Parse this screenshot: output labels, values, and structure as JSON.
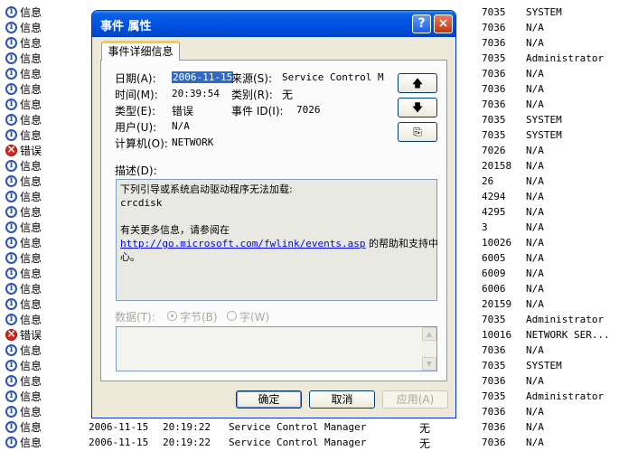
{
  "event_list": {
    "rows": [
      {
        "type": "信息",
        "icon": "info",
        "date": "",
        "time": "",
        "source": "",
        "category": "",
        "id": "7035",
        "user": "SYSTEM"
      },
      {
        "type": "信息",
        "icon": "info",
        "date": "",
        "time": "",
        "source": "",
        "category": "",
        "id": "7036",
        "user": "N/A"
      },
      {
        "type": "信息",
        "icon": "info",
        "date": "",
        "time": "",
        "source": "",
        "category": "",
        "id": "7036",
        "user": "N/A"
      },
      {
        "type": "信息",
        "icon": "info",
        "date": "",
        "time": "",
        "source": "",
        "category": "",
        "id": "7035",
        "user": "Administrator"
      },
      {
        "type": "信息",
        "icon": "info",
        "date": "",
        "time": "",
        "source": "",
        "category": "",
        "id": "7036",
        "user": "N/A"
      },
      {
        "type": "信息",
        "icon": "info",
        "date": "",
        "time": "",
        "source": "",
        "category": "",
        "id": "7036",
        "user": "N/A"
      },
      {
        "type": "信息",
        "icon": "info",
        "date": "",
        "time": "",
        "source": "",
        "category": "",
        "id": "7036",
        "user": "N/A"
      },
      {
        "type": "信息",
        "icon": "info",
        "date": "",
        "time": "",
        "source": "",
        "category": "",
        "id": "7035",
        "user": "SYSTEM"
      },
      {
        "type": "信息",
        "icon": "info",
        "date": "",
        "time": "",
        "source": "",
        "category": "",
        "id": "7035",
        "user": "SYSTEM"
      },
      {
        "type": "错误",
        "icon": "error",
        "date": "",
        "time": "",
        "source": "",
        "category": "",
        "id": "7026",
        "user": "N/A"
      },
      {
        "type": "信息",
        "icon": "info",
        "date": "",
        "time": "",
        "source": "",
        "category": "",
        "id": "20158",
        "user": "N/A"
      },
      {
        "type": "信息",
        "icon": "info",
        "date": "",
        "time": "",
        "source": "",
        "category": "",
        "id": "26",
        "user": "N/A"
      },
      {
        "type": "信息",
        "icon": "info",
        "date": "",
        "time": "",
        "source": "",
        "category": "",
        "id": "4294",
        "user": "N/A"
      },
      {
        "type": "信息",
        "icon": "info",
        "date": "",
        "time": "",
        "source": "",
        "category": "",
        "id": "4295",
        "user": "N/A"
      },
      {
        "type": "信息",
        "icon": "info",
        "date": "",
        "time": "",
        "source": "",
        "category": "",
        "id": "3",
        "user": "N/A"
      },
      {
        "type": "信息",
        "icon": "info",
        "date": "",
        "time": "",
        "source": "",
        "category": "",
        "id": "10026",
        "user": "N/A"
      },
      {
        "type": "信息",
        "icon": "info",
        "date": "",
        "time": "",
        "source": "",
        "category": "",
        "id": "6005",
        "user": "N/A"
      },
      {
        "type": "信息",
        "icon": "info",
        "date": "",
        "time": "",
        "source": "",
        "category": "",
        "id": "6009",
        "user": "N/A"
      },
      {
        "type": "信息",
        "icon": "info",
        "date": "",
        "time": "",
        "source": "",
        "category": "",
        "id": "6006",
        "user": "N/A"
      },
      {
        "type": "信息",
        "icon": "info",
        "date": "",
        "time": "",
        "source": "",
        "category": "",
        "id": "20159",
        "user": "N/A"
      },
      {
        "type": "信息",
        "icon": "info",
        "date": "",
        "time": "",
        "source": "",
        "category": "",
        "id": "7035",
        "user": "Administrator"
      },
      {
        "type": "错误",
        "icon": "error",
        "date": "",
        "time": "",
        "source": "",
        "category": "",
        "id": "10016",
        "user": "NETWORK SER..."
      },
      {
        "type": "信息",
        "icon": "info",
        "date": "",
        "time": "",
        "source": "",
        "category": "",
        "id": "7036",
        "user": "N/A"
      },
      {
        "type": "信息",
        "icon": "info",
        "date": "",
        "time": "",
        "source": "",
        "category": "",
        "id": "7035",
        "user": "SYSTEM"
      },
      {
        "type": "信息",
        "icon": "info",
        "date": "",
        "time": "",
        "source": "",
        "category": "",
        "id": "7036",
        "user": "N/A"
      },
      {
        "type": "信息",
        "icon": "info",
        "date": "",
        "time": "",
        "source": "",
        "category": "",
        "id": "7035",
        "user": "Administrator"
      },
      {
        "type": "信息",
        "icon": "info",
        "date": "",
        "time": "",
        "source": "",
        "category": "",
        "id": "7036",
        "user": "N/A"
      },
      {
        "type": "信息",
        "icon": "info",
        "date": "2006-11-15",
        "time": "20:19:22",
        "source": "Service Control Manager",
        "category": "无",
        "id": "7036",
        "user": "N/A"
      },
      {
        "type": "信息",
        "icon": "info",
        "date": "2006-11-15",
        "time": "20:19:22",
        "source": "Service Control Manager",
        "category": "无",
        "id": "7036",
        "user": "N/A"
      }
    ]
  },
  "dialog": {
    "title": "事件 属性",
    "help_label": "?",
    "close_label": "×",
    "tab_label": "事件详细信息",
    "fields": {
      "date_label": "日期(A):",
      "date_value": "2006-11-15",
      "source_label": "来源(S):",
      "source_value": "Service Control M",
      "time_label": "时间(M):",
      "time_value": "20:39:54",
      "category_label": "类别(R):",
      "category_value": "无",
      "type_label": "类型(E):",
      "type_value": "错误",
      "event_id_label": "事件 ID(I):",
      "event_id_value": "7026",
      "user_label": "用户(U):",
      "user_value": "N/A",
      "computer_label": "计算机(O):",
      "computer_value": "NETWORK"
    },
    "nav_buttons": {
      "up": "🡅",
      "down": "🡇",
      "copy": "⎘"
    },
    "description_label": "描述(D):",
    "description": {
      "line1": "下列引导或系统启动驱动程序无法加载:",
      "line2": "crcdisk",
      "line3": "有关更多信息，请参阅在",
      "link": "http://go.microsoft.com/fwlink/events.asp",
      "line4_suffix": " 的帮助和支持中",
      "line5": "心。"
    },
    "data_label": "数据(T):",
    "radio_bytes": "字节(B)",
    "radio_words": "字(W)",
    "buttons": {
      "ok": "确定",
      "cancel": "取消",
      "apply": "应用(A)"
    }
  }
}
